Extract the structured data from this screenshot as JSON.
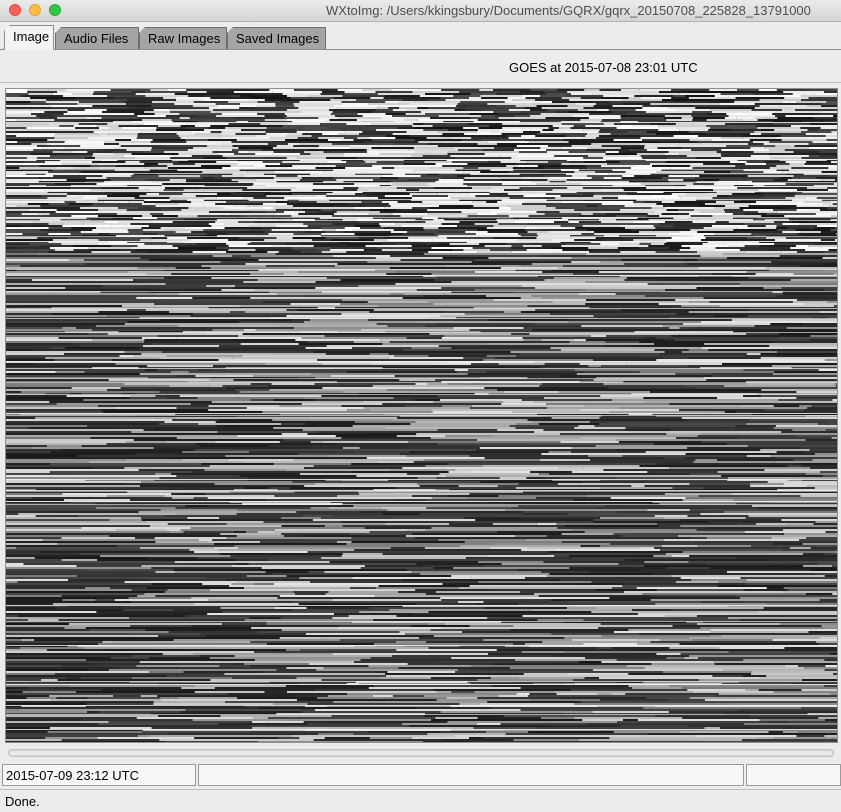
{
  "window": {
    "title": "WXtoImg: /Users/kkingsbury/Documents/GQRX/gqrx_20150708_225828_13791000"
  },
  "tabs": [
    {
      "label": "Image",
      "active": true
    },
    {
      "label": "Audio Files",
      "active": false
    },
    {
      "label": "Raw Images",
      "active": false
    },
    {
      "label": "Saved Images",
      "active": false
    }
  ],
  "image": {
    "heading": "GOES at 2015-07-08  23:01 UTC"
  },
  "status": {
    "time_field": "2015-07-09  23:12 UTC",
    "field2": "",
    "field3": "",
    "message": "Done."
  }
}
